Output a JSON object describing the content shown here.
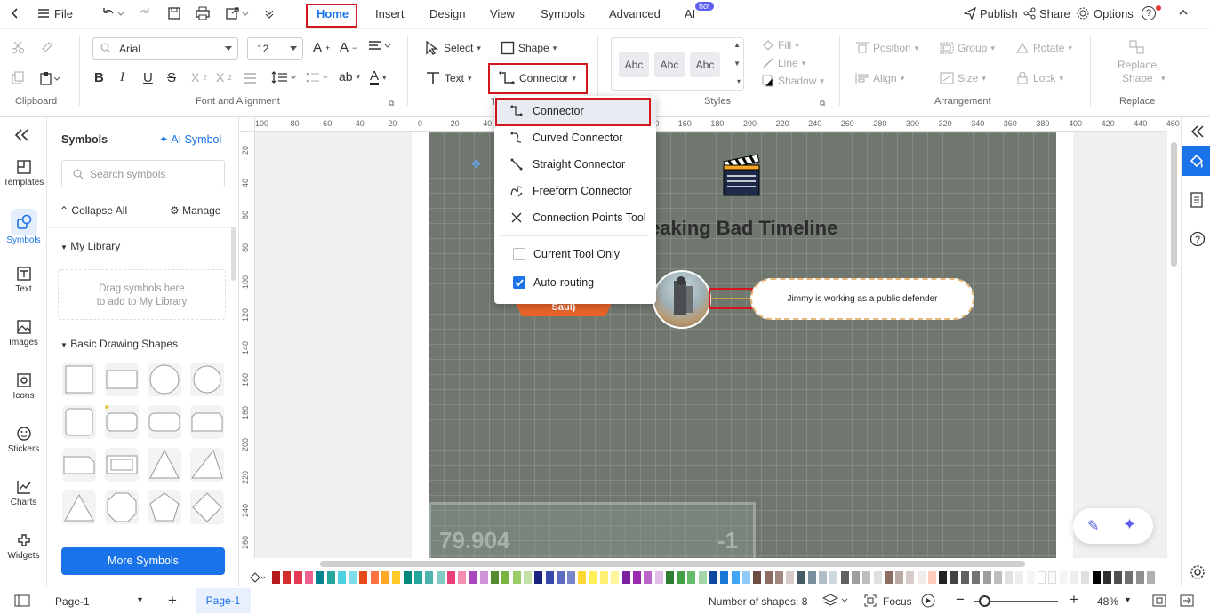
{
  "topbar": {
    "file_label": "File",
    "tabs": [
      {
        "label": "Home",
        "active": true
      },
      {
        "label": "Insert"
      },
      {
        "label": "Design"
      },
      {
        "label": "View"
      },
      {
        "label": "Symbols"
      },
      {
        "label": "Advanced"
      },
      {
        "label": "AI"
      }
    ],
    "ai_badge": "hot",
    "publish_label": "Publish",
    "share_label": "Share",
    "options_label": "Options",
    "help_label": "?"
  },
  "ribbon": {
    "clipboard_label": "Clipboard",
    "font_name": "Arial",
    "font_size": "12",
    "font_group_label": "Font and Alignment",
    "select_label": "Select",
    "shape_label": "Shape",
    "text_label": "Text",
    "connector_label": "Connector",
    "styles_label": "Styles",
    "style_samples": [
      "Abc",
      "Abc",
      "Abc"
    ],
    "fill_label": "Fill",
    "line_label": "Line",
    "shadow_label": "Shadow",
    "position_label": "Position",
    "group_label": "Group",
    "rotate_label": "Rotate",
    "align_label": "Align",
    "size_label": "Size",
    "lock_label": "Lock",
    "arrangement_label": "Arrangement",
    "replace_shape_label_1": "Replace",
    "replace_shape_label_2": "Shape",
    "replace_label": "Replace"
  },
  "connector_menu": {
    "items": [
      {
        "label": "Connector",
        "icon": "connector-icon",
        "highlighted": true
      },
      {
        "label": "Curved Connector",
        "icon": "curved-connector-icon"
      },
      {
        "label": "Straight Connector",
        "icon": "straight-connector-icon"
      },
      {
        "label": "Freeform Connector",
        "icon": "freeform-connector-icon"
      },
      {
        "label": "Connection Points Tool",
        "icon": "connection-points-icon"
      }
    ],
    "current_tool_only": {
      "label": "Current Tool Only",
      "checked": false
    },
    "auto_routing": {
      "label": "Auto-routing",
      "checked": true
    }
  },
  "leftnav": {
    "items": [
      {
        "label": "Templates",
        "icon": "templates-icon"
      },
      {
        "label": "Symbols",
        "icon": "symbols-icon",
        "active": true
      },
      {
        "label": "Text",
        "icon": "text-icon"
      },
      {
        "label": "Images",
        "icon": "images-icon"
      },
      {
        "label": "Icons",
        "icon": "icons-icon"
      },
      {
        "label": "Stickers",
        "icon": "stickers-icon"
      },
      {
        "label": "Charts",
        "icon": "charts-icon"
      },
      {
        "label": "Widgets",
        "icon": "widgets-icon"
      }
    ]
  },
  "library": {
    "title": "Symbols",
    "ai_symbol_label": "AI Symbol",
    "search_placeholder": "Search symbols",
    "collapse_all_label": "Collapse All",
    "manage_label": "Manage",
    "my_library_label": "My Library",
    "my_library_hint_1": "Drag symbols here",
    "my_library_hint_2": "to add to My Library",
    "basic_shapes_label": "Basic Drawing Shapes",
    "more_symbols_label": "More Symbols"
  },
  "ruler": {
    "h_ticks": [
      "100",
      "-80",
      "-60",
      "-40",
      "-20",
      "0",
      "20",
      "40",
      "60",
      "80",
      "100",
      "120",
      "140",
      "160",
      "180",
      "200",
      "220",
      "240",
      "260",
      "280",
      "300",
      "320",
      "340",
      "360",
      "380",
      "400",
      "420",
      "440",
      "460"
    ],
    "v_ticks": [
      "20",
      "40",
      "60",
      "80",
      "100",
      "120",
      "140",
      "160",
      "180",
      "200",
      "220",
      "240",
      "260"
    ]
  },
  "canvas": {
    "title_visible": "eaking Bad Timeline",
    "orange_label": "Saul)",
    "event_text": "Jimmy is working as a public defender",
    "bg_number_left": "79.904",
    "bg_number_right": "-1"
  },
  "colors": {
    "accent": "#1a73e8",
    "highlight_red": "#d4171d",
    "board_bg": "#6f776f",
    "orange_tag": "#e8642a"
  },
  "statusbar": {
    "page_select": "Page-1",
    "page_tab": "Page-1",
    "shape_count": "Number of shapes: 8",
    "focus_label": "Focus",
    "zoom": "48%"
  }
}
